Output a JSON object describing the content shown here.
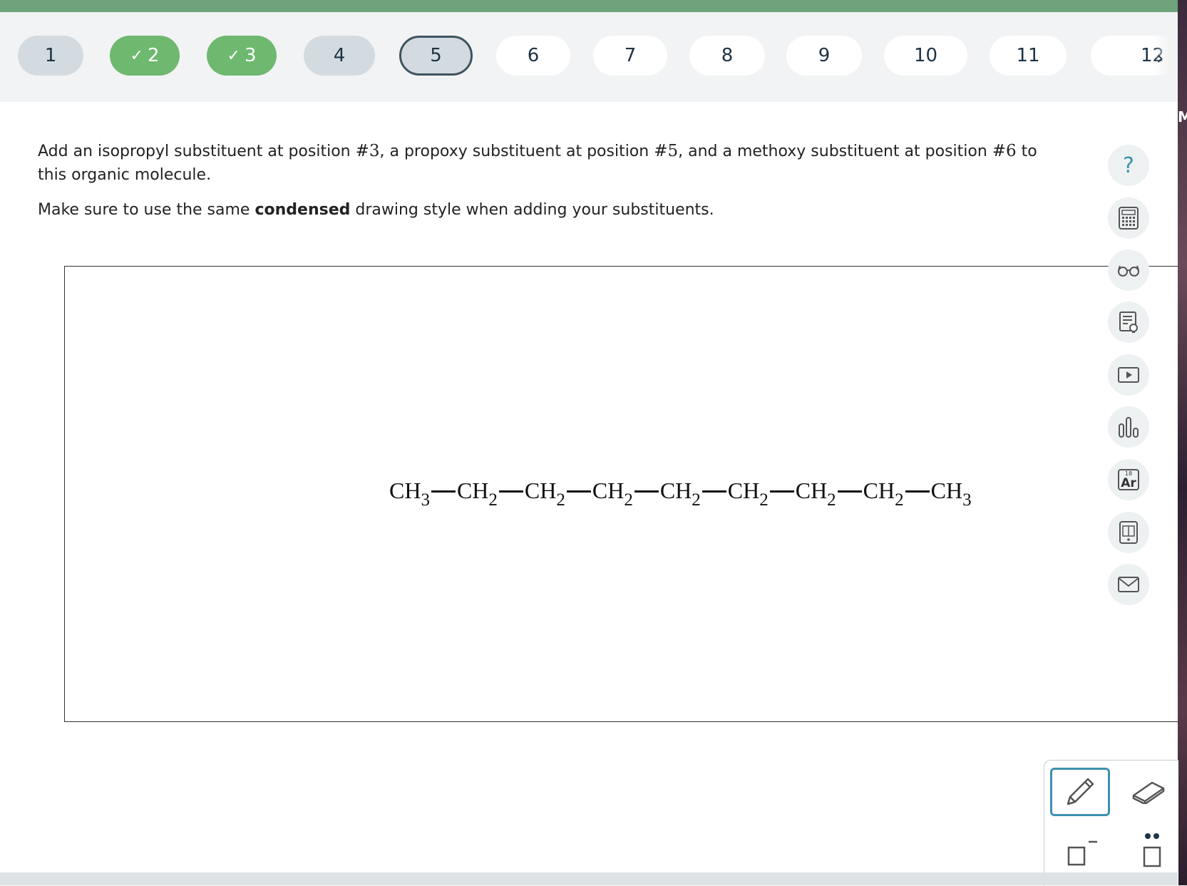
{
  "nav": {
    "questions": [
      {
        "label": "1",
        "state": "visited"
      },
      {
        "label": "2",
        "state": "correct"
      },
      {
        "label": "3",
        "state": "correct"
      },
      {
        "label": "4",
        "state": "visited"
      },
      {
        "label": "5",
        "state": "current"
      },
      {
        "label": "6",
        "state": "unvisited"
      },
      {
        "label": "7",
        "state": "unvisited"
      },
      {
        "label": "8",
        "state": "unvisited"
      },
      {
        "label": "9",
        "state": "unvisited"
      },
      {
        "label": "10",
        "state": "unvisited"
      },
      {
        "label": "11",
        "state": "unvisited"
      },
      {
        "label": "12",
        "state": "unvisited"
      }
    ],
    "check_glyph": "✓",
    "next_glyph": "›"
  },
  "prompt": {
    "line1_a": "Add an isopropyl substituent at position ",
    "pos1": "#3",
    "line1_b": ", a propoxy substituent at position ",
    "pos2": "#5",
    "line1_c": ", and a methoxy substituent at position ",
    "pos3": "#6",
    "line1_d": " to this organic molecule.",
    "line2_a": "Make sure to use the same ",
    "line2_bold": "condensed",
    "line2_b": " drawing style when adding your substituents."
  },
  "molecule": {
    "groups": [
      {
        "base": "CH",
        "sub": "3"
      },
      {
        "base": "CH",
        "sub": "2"
      },
      {
        "base": "CH",
        "sub": "2"
      },
      {
        "base": "CH",
        "sub": "2"
      },
      {
        "base": "CH",
        "sub": "2"
      },
      {
        "base": "CH",
        "sub": "2"
      },
      {
        "base": "CH",
        "sub": "2"
      },
      {
        "base": "CH",
        "sub": "2"
      },
      {
        "base": "CH",
        "sub": "3"
      }
    ]
  },
  "tools": {
    "help_glyph": "?",
    "periodic_number": "18",
    "periodic_symbol": "Ar"
  },
  "colors": {
    "correct": "#6eb870",
    "visited": "#d3dbe0",
    "accent": "#3e90b0",
    "header": "#6ea37c"
  },
  "edge_char": "M"
}
